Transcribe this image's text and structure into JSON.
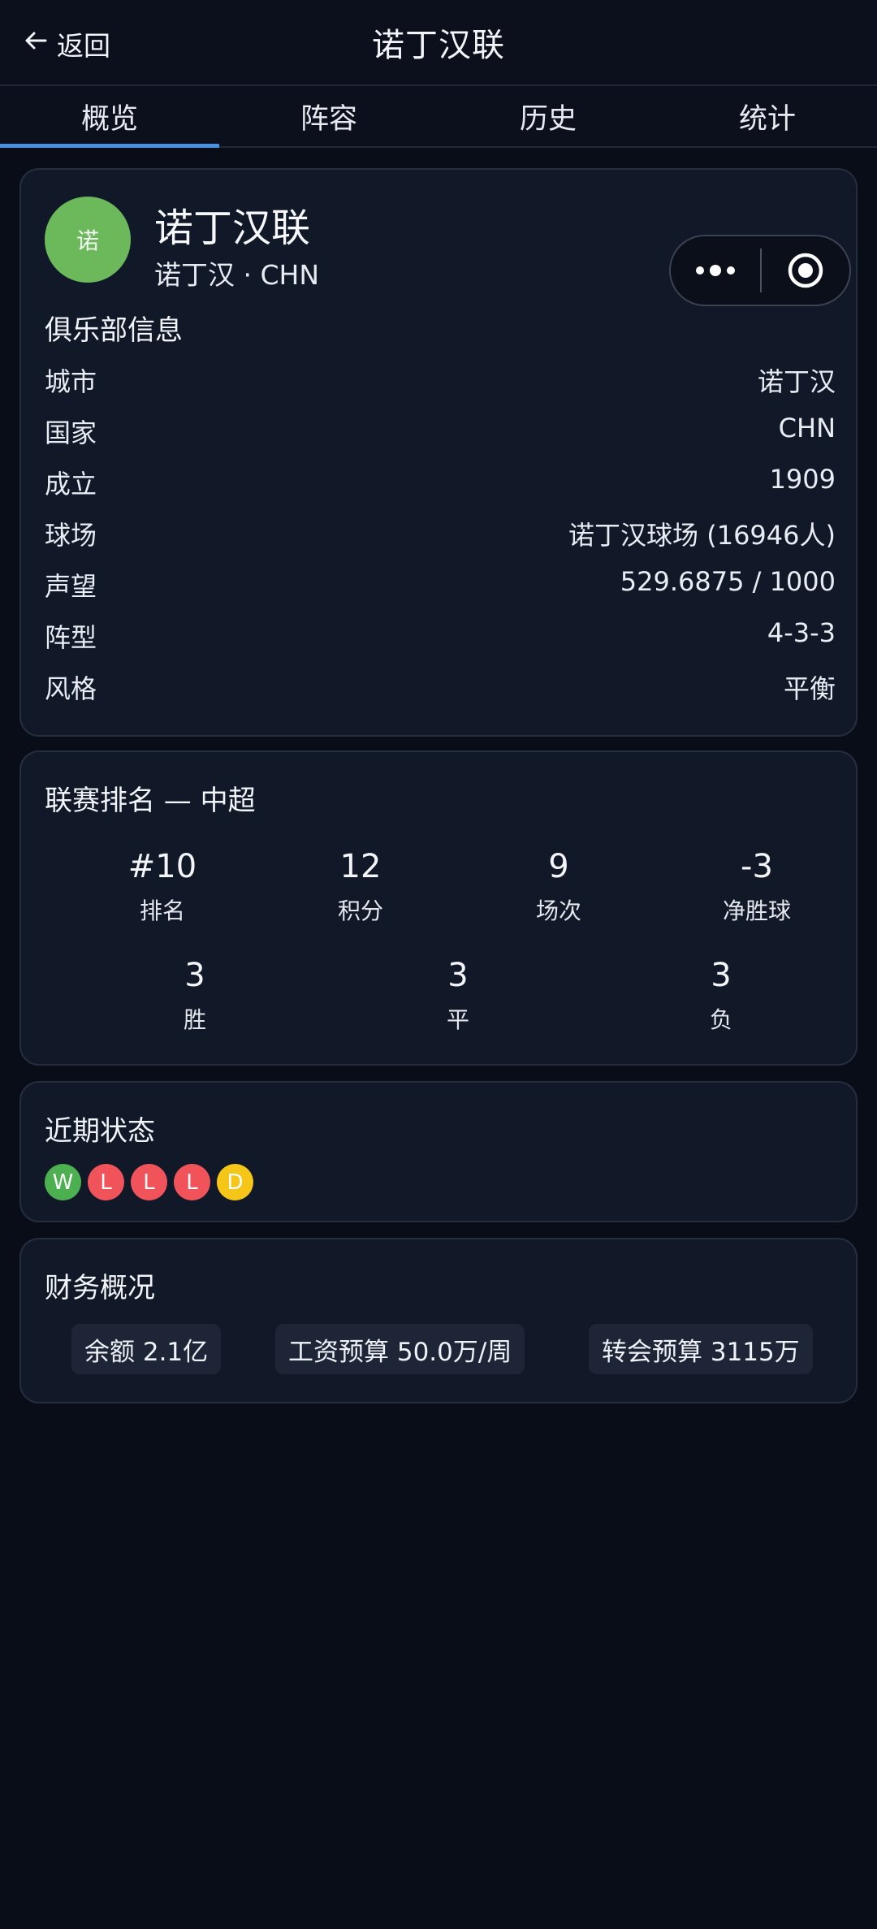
{
  "header": {
    "back_label": "返回",
    "title": "诺丁汉联"
  },
  "tabs": [
    {
      "label": "概览",
      "active": true
    },
    {
      "label": "阵容",
      "active": false
    },
    {
      "label": "历史",
      "active": false
    },
    {
      "label": "统计",
      "active": false
    }
  ],
  "club": {
    "avatar_text": "诺",
    "avatar_color": "#6bb95b",
    "name": "诺丁汉联",
    "subtitle": "诺丁汉 · CHN",
    "section_title": "俱乐部信息",
    "info": [
      {
        "label": "城市",
        "value": "诺丁汉"
      },
      {
        "label": "国家",
        "value": "CHN"
      },
      {
        "label": "成立",
        "value": "1909"
      },
      {
        "label": "球场",
        "value": "诺丁汉球场 (16946人)"
      },
      {
        "label": "声望",
        "value": "529.6875 / 1000"
      },
      {
        "label": "阵型",
        "value": "4-3-3"
      },
      {
        "label": "风格",
        "value": "平衡"
      }
    ]
  },
  "league": {
    "title": "联赛排名 — 中超",
    "row1": [
      {
        "value": "#10",
        "label": "排名"
      },
      {
        "value": "12",
        "label": "积分"
      },
      {
        "value": "9",
        "label": "场次"
      },
      {
        "value": "-3",
        "label": "净胜球"
      }
    ],
    "row2": [
      {
        "value": "3",
        "label": "胜"
      },
      {
        "value": "3",
        "label": "平"
      },
      {
        "value": "3",
        "label": "负"
      }
    ]
  },
  "form": {
    "title": "近期状态",
    "results": [
      {
        "letter": "W",
        "color": "#4caf50"
      },
      {
        "letter": "L",
        "color": "#f0545a"
      },
      {
        "letter": "L",
        "color": "#f0545a"
      },
      {
        "letter": "L",
        "color": "#f0545a"
      },
      {
        "letter": "D",
        "color": "#f5c518"
      }
    ]
  },
  "finance": {
    "title": "财务概况",
    "chips": [
      "余额 2.1亿",
      "工资预算 50.0万/周",
      "转会预算 3115万"
    ]
  },
  "colors": {
    "accent": "#4a90e2",
    "background": "#090d17",
    "card": "#111827"
  }
}
